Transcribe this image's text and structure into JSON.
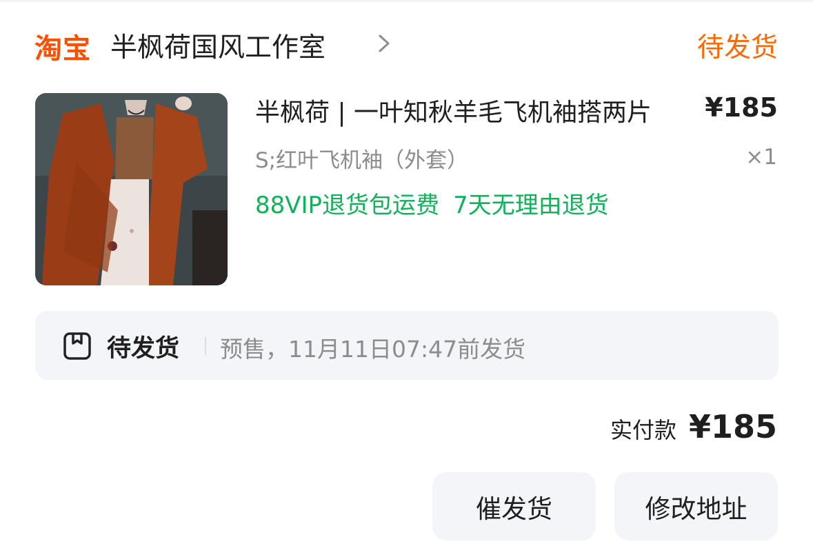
{
  "header": {
    "brand": "淘宝",
    "shop_name": "半枫荷国风工作室",
    "order_status": "待发货",
    "brand_color": "#ff5000"
  },
  "product": {
    "title": "半枫荷 | 一叶知秋羊毛飞机袖搭两片",
    "price": "¥185",
    "sku": "S;红叶飞机袖（外套）",
    "quantity": "×1",
    "services": [
      "88VIP退货包运费",
      "7天无理由退货"
    ],
    "service_color": "#11b05a"
  },
  "delivery": {
    "status": "待发货",
    "detail": "预售，11月11日07:47前发货"
  },
  "total": {
    "label": "实付款",
    "value": "¥185"
  },
  "actions": {
    "urge_label": "催发货",
    "address_label": "修改地址"
  }
}
